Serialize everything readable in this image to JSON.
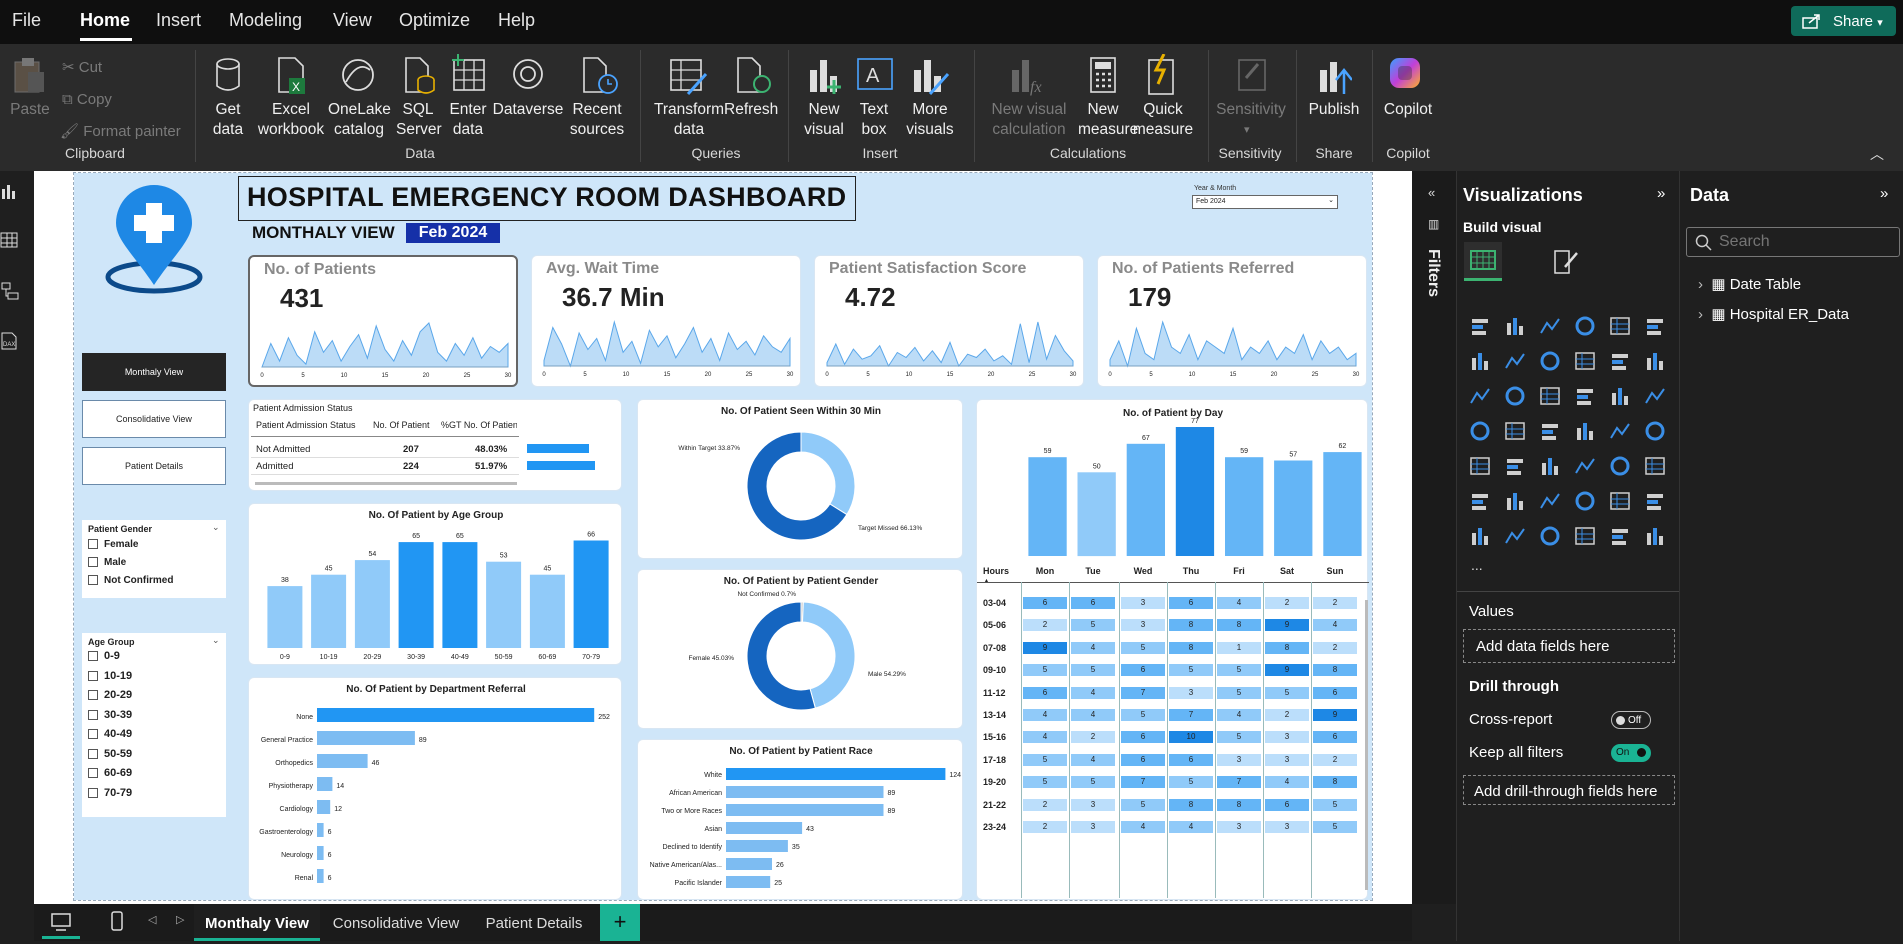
{
  "menu": {
    "items": [
      "File",
      "Home",
      "Insert",
      "Modeling",
      "View",
      "Optimize",
      "Help"
    ],
    "share": "Share"
  },
  "ribbon": {
    "clipboard": {
      "paste": "Paste",
      "cut": "Cut",
      "copy": "Copy",
      "format_painter": "Format painter",
      "group": "Clipboard"
    },
    "data": {
      "get_data": "Get data",
      "excel": "Excel workbook",
      "onelake": "OneLake catalog",
      "sql": "SQL Server",
      "enter": "Enter data",
      "dataverse": "Dataverse",
      "recent": "Recent sources",
      "group": "Data"
    },
    "queries": {
      "transform": "Transform data",
      "refresh": "Refresh",
      "group": "Queries"
    },
    "insert": {
      "new_visual": "New visual",
      "text_box": "Text box",
      "more_visuals": "More visuals",
      "group": "Insert"
    },
    "calculations": {
      "new_visual_calc": "New visual calculation",
      "new_measure": "New measure",
      "quick_measure": "Quick measure",
      "group": "Calculations"
    },
    "sensitivity": {
      "label": "Sensitivity",
      "group": "Sensitivity"
    },
    "share": {
      "publish": "Publish",
      "group": "Share"
    },
    "copilot": {
      "label": "Copilot",
      "group": "Copilot"
    }
  },
  "report": {
    "title": "HOSPITAL EMERGENCY ROOM DASHBOARD",
    "subtitle": "MONTHALY VIEW",
    "month_badge": "Feb 2024",
    "year_month_label": "Year & Month",
    "year_month_value": "Feb 2024",
    "nav": [
      "Monthaly View",
      "Consolidative View",
      "Patient Details"
    ],
    "gender_slicer": {
      "title": "Patient Gender",
      "options": [
        "Female",
        "Male",
        "Not Confirmed"
      ]
    },
    "age_slicer": {
      "title": "Age Group",
      "options": [
        "0-9",
        "10-19",
        "20-29",
        "30-39",
        "40-49",
        "50-59",
        "60-69",
        "70-79"
      ]
    },
    "kpis": [
      {
        "title": "No. of Patients",
        "value": "431"
      },
      {
        "title": "Avg. Wait Time",
        "value": "36.7 Min"
      },
      {
        "title": "Patient Satisfaction Score",
        "value": "4.72"
      },
      {
        "title": "No. of Patients Referred",
        "value": "179"
      }
    ],
    "kpi_axis": [
      "0",
      "5",
      "10",
      "15",
      "20",
      "25",
      "30"
    ],
    "admission": {
      "title": "Patient Admission Status",
      "headers": [
        "Patient Admission Status",
        "No. Of Patient",
        "%GT No. Of Patient"
      ],
      "rows": [
        {
          "status": "Not Admitted",
          "count": "207",
          "pct": "48.03%",
          "frac": 0.4803
        },
        {
          "status": "Admitted",
          "count": "224",
          "pct": "51.97%",
          "frac": 0.5197
        }
      ]
    },
    "seen30": {
      "title": "No. Of Patient Seen Within 30 Min",
      "labels": [
        "Within Target 33.87%",
        "Target Missed 66.13%"
      ],
      "values": [
        33.87,
        66.13
      ]
    },
    "gender": {
      "title": "No. Of Patient by Patient Gender",
      "labels": [
        "Not Confirmed 0.7%",
        "Female 45.03%",
        "Male 54.29%"
      ],
      "values": [
        0.7,
        45.03,
        54.29
      ]
    },
    "colors": {
      "dark": "#1565c0",
      "mid": "#2196f3",
      "light": "#90caf9",
      "accent": "#1e88e5",
      "badge": "#1530a8"
    }
  },
  "chart_data": [
    {
      "type": "line",
      "title": "No. of Patients",
      "x": [
        1,
        2,
        3,
        4,
        5,
        6,
        7,
        8,
        9,
        10,
        11,
        12,
        13,
        14,
        15,
        16,
        17,
        18,
        19,
        20,
        21,
        22,
        23,
        24,
        25,
        26,
        27,
        28,
        29
      ],
      "values": [
        10,
        18,
        12,
        20,
        14,
        11,
        22,
        15,
        19,
        12,
        17,
        21,
        13,
        24,
        16,
        12,
        19,
        14,
        22,
        25,
        15,
        12,
        18,
        14,
        20,
        13,
        17,
        15,
        18
      ]
    },
    {
      "type": "line",
      "title": "Avg. Wait Time",
      "x": [
        1,
        2,
        3,
        4,
        5,
        6,
        7,
        8,
        9,
        10,
        11,
        12,
        13,
        14,
        15,
        16,
        17,
        18,
        19,
        20,
        21,
        22,
        23,
        24,
        25,
        26,
        27,
        28,
        29
      ],
      "values": [
        30,
        42,
        36,
        28,
        40,
        34,
        38,
        30,
        44,
        33,
        37,
        29,
        41,
        35,
        39,
        31,
        36,
        42,
        33,
        38,
        30,
        40,
        34,
        37,
        32,
        39,
        35,
        33,
        38
      ]
    },
    {
      "type": "line",
      "title": "Patient Satisfaction Score",
      "x": [
        1,
        2,
        3,
        4,
        5,
        6,
        7,
        8,
        9,
        10,
        11,
        12,
        13,
        14,
        15,
        16,
        17,
        18,
        19,
        20,
        21,
        22,
        23,
        24,
        25,
        26,
        27,
        28,
        29
      ],
      "values": [
        4.2,
        5.3,
        4.1,
        5.0,
        4.4,
        4.6,
        5.2,
        4.0,
        4.8,
        4.5,
        5.1,
        4.3,
        4.9,
        4.2,
        5.4,
        4.0,
        4.7,
        4.5,
        5.0,
        4.3,
        4.6,
        4.1,
        6.5,
        4.2,
        6.6,
        4.4,
        5.8,
        4.9,
        4.3
      ]
    },
    {
      "type": "line",
      "title": "No. of Patients Referred",
      "x": [
        1,
        2,
        3,
        4,
        5,
        6,
        7,
        8,
        9,
        10,
        11,
        12,
        13,
        14,
        15,
        16,
        17,
        18,
        19,
        20,
        21,
        22,
        23,
        24,
        25,
        26,
        27,
        28,
        29
      ],
      "values": [
        6,
        9,
        5,
        11,
        7,
        6,
        12,
        8,
        7,
        10,
        6,
        9,
        8,
        7,
        11,
        6,
        8,
        7,
        9,
        6,
        8,
        7,
        10,
        6,
        9,
        7,
        8,
        6,
        7
      ]
    },
    {
      "type": "bar",
      "title": "No. Of Patient by Age Group",
      "categories": [
        "0-9",
        "10-19",
        "20-29",
        "30-39",
        "40-49",
        "50-59",
        "60-69",
        "70-79"
      ],
      "values": [
        38,
        45,
        54,
        65,
        65,
        53,
        45,
        66
      ]
    },
    {
      "type": "bar",
      "title": "No. Of Patient by Department Referral",
      "categories": [
        "None",
        "General Practice",
        "Orthopedics",
        "Physiotherapy",
        "Cardiology",
        "Gastroenterology",
        "Neurology",
        "Renal"
      ],
      "values": [
        252,
        89,
        46,
        14,
        12,
        6,
        6,
        6
      ]
    },
    {
      "type": "bar",
      "title": "No. Of Patient by Patient Race",
      "categories": [
        "White",
        "African American",
        "Two or More Races",
        "Asian",
        "Declined to Identify",
        "Native American/Alas...",
        "Pacific Islander"
      ],
      "values": [
        124,
        89,
        89,
        43,
        35,
        26,
        25
      ]
    },
    {
      "type": "bar",
      "title": "No. of Patient by Day",
      "categories": [
        "Mon",
        "Tue",
        "Wed",
        "Thu",
        "Fri",
        "Sat",
        "Sun"
      ],
      "values": [
        59,
        50,
        67,
        77,
        59,
        57,
        62
      ]
    },
    {
      "type": "heatmap",
      "title": "Hours",
      "columns": [
        "Mon",
        "Tue",
        "Wed",
        "Thu",
        "Fri",
        "Sat",
        "Sun"
      ],
      "rows": [
        "03-04",
        "05-06",
        "07-08",
        "09-10",
        "11-12",
        "13-14",
        "15-16",
        "17-18",
        "19-20",
        "21-22",
        "23-24"
      ],
      "values": [
        [
          6,
          6,
          3,
          6,
          4,
          2,
          2
        ],
        [
          2,
          5,
          3,
          8,
          8,
          9,
          4
        ],
        [
          9,
          4,
          5,
          8,
          1,
          8,
          2
        ],
        [
          5,
          5,
          6,
          5,
          5,
          9,
          8
        ],
        [
          6,
          4,
          7,
          3,
          5,
          5,
          6
        ],
        [
          4,
          4,
          5,
          7,
          4,
          2,
          9
        ],
        [
          4,
          2,
          6,
          10,
          5,
          3,
          6
        ],
        [
          5,
          4,
          6,
          6,
          3,
          3,
          2
        ],
        [
          5,
          5,
          7,
          5,
          7,
          4,
          8
        ],
        [
          2,
          3,
          5,
          8,
          8,
          6,
          5
        ],
        [
          2,
          3,
          4,
          4,
          3,
          3,
          5
        ]
      ]
    }
  ],
  "filters": {
    "label": "Filters"
  },
  "visualizations": {
    "title": "Visualizations",
    "build": "Build visual",
    "values": "Values",
    "add_fields": "Add data fields here",
    "drill": "Drill through",
    "cross_report": "Cross-report",
    "cross_state": "Off",
    "keep_filters": "Keep all filters",
    "keep_state": "On",
    "add_drill": "Add drill-through fields here",
    "more": "..."
  },
  "data_pane": {
    "title": "Data",
    "search_placeholder": "Search",
    "tables": [
      "Date Table",
      "Hospital ER_Data"
    ]
  },
  "tabs": [
    "Monthaly View",
    "Consolidative View",
    "Patient Details"
  ]
}
